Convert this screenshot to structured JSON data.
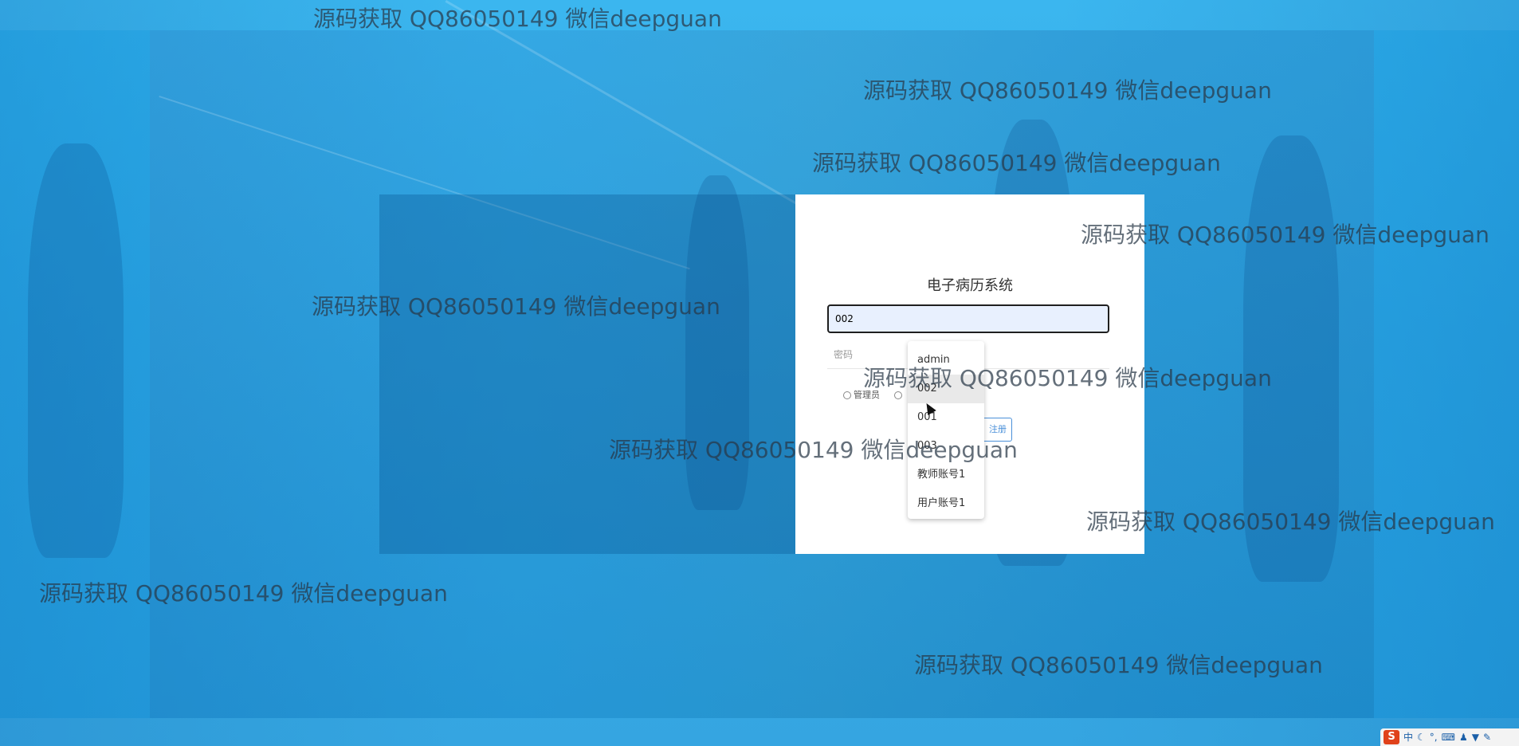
{
  "login": {
    "title": "电子病历系统",
    "username_value": "002",
    "password_placeholder": "密码",
    "roles": [
      "管理员"
    ],
    "register_label": "注册"
  },
  "autocomplete": {
    "options": [
      "admin",
      "002",
      "001",
      "003",
      "教师账号1",
      "用户账号1"
    ],
    "highlighted": "002"
  },
  "watermark_text": "源码获取 QQ86050149 微信deepguan",
  "ime_toolbar": {
    "logo": "S",
    "mode": "中",
    "icons": [
      "moon-icon",
      "punctuation-icon",
      "keyboard-icon",
      "user-icon",
      "shirt-icon",
      "tool-icon"
    ]
  }
}
